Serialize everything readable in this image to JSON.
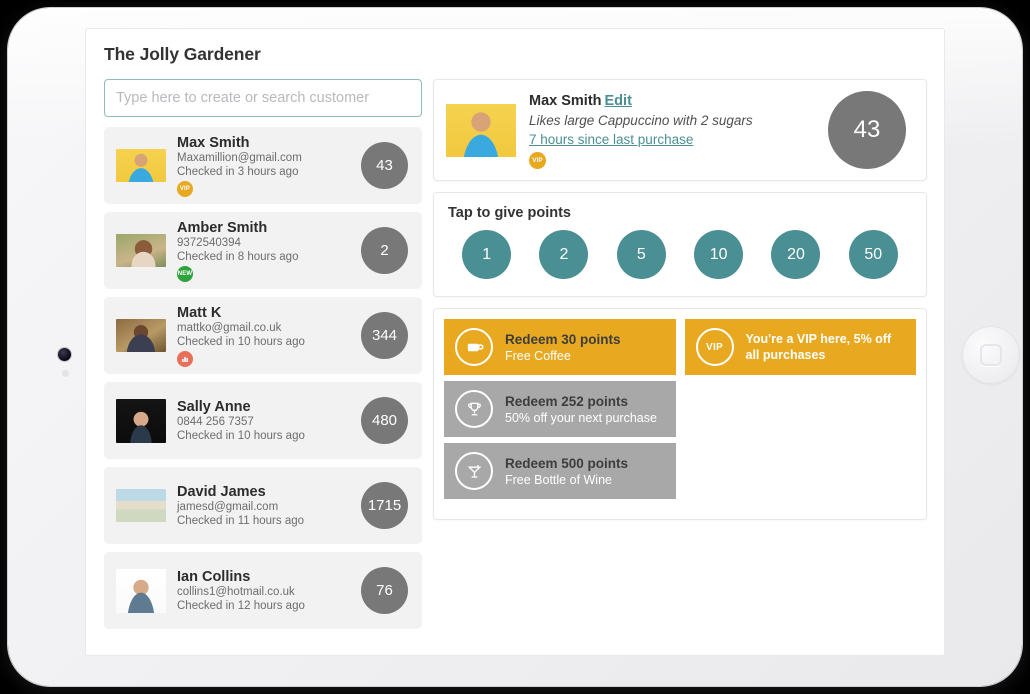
{
  "device": {
    "camera_icon": "camera-lens",
    "sensor_icon": "ambient-light-sensor",
    "home_button_icon": "home-button"
  },
  "app": {
    "title": "The Jolly Gardener"
  },
  "search": {
    "placeholder": "Type here to create or search customer",
    "value": "",
    "border_color": "#8fbcbb"
  },
  "customer_list": [
    {
      "name": "Max Smith",
      "contact": "Maxamillion@gmail.com",
      "checkin": "Checked in 3 hours ago",
      "points": "43",
      "badge": "VIP",
      "badge_type": "vip",
      "avatar": "photo-man-yellow-background"
    },
    {
      "name": "Amber Smith",
      "contact": "9372540394",
      "checkin": "Checked in 8 hours ago",
      "points": "2",
      "badge": "NEW",
      "badge_type": "new",
      "avatar": "photo-woman-outdoors"
    },
    {
      "name": "Matt K",
      "contact": "mattko@gmail.co.uk",
      "checkin": "Checked in 10 hours ago",
      "points": "344",
      "badge": "",
      "badge_type": "chart",
      "avatar": "photo-man-plaid-shirt"
    },
    {
      "name": "Sally Anne",
      "contact": "0844 256 7357",
      "checkin": "Checked in 10 hours ago",
      "points": "480",
      "badge": "",
      "badge_type": "none",
      "avatar": "photo-woman-dark-background"
    },
    {
      "name": "David James",
      "contact": "jamesd@gmail.com",
      "checkin": "Checked in 11 hours ago",
      "points": "1715",
      "badge": "",
      "badge_type": "none",
      "avatar": "photo-beach-scene"
    },
    {
      "name": "Ian Collins",
      "contact": "collins1@hotmail.co.uk",
      "checkin": "Checked in 12 hours ago",
      "points": "76",
      "badge": "",
      "badge_type": "none",
      "avatar": "photo-bald-man-white-background"
    }
  ],
  "detail": {
    "name": "Max Smith",
    "edit_label": "Edit",
    "note": "Likes large Cappuccino with 2 sugars",
    "last_purchase": "7 hours since last purchase",
    "badge": "VIP",
    "points": "43",
    "avatar": "photo-man-yellow-background"
  },
  "points_panel": {
    "title": "Tap to give points",
    "options": [
      "1",
      "2",
      "5",
      "10",
      "20",
      "50"
    ],
    "chip_color": "#4a8f94"
  },
  "rewards": {
    "available_color": "#e8a921",
    "locked_color": "#a8a8a8",
    "left_column": [
      {
        "title": "Redeem 30 points",
        "subtitle": "Free Coffee",
        "state": "available",
        "icon": "coffee-cup-icon"
      },
      {
        "title": "Redeem 252 points",
        "subtitle": "50% off your next purchase",
        "state": "locked",
        "icon": "trophy-icon"
      },
      {
        "title": "Redeem 500 points",
        "subtitle": "Free Bottle of Wine",
        "state": "locked",
        "icon": "cocktail-glass-icon"
      }
    ],
    "right_column": [
      {
        "badge": "VIP",
        "text": "You're a VIP here, 5% off all purchases",
        "state": "available",
        "icon": "vip-ring-icon"
      }
    ]
  }
}
